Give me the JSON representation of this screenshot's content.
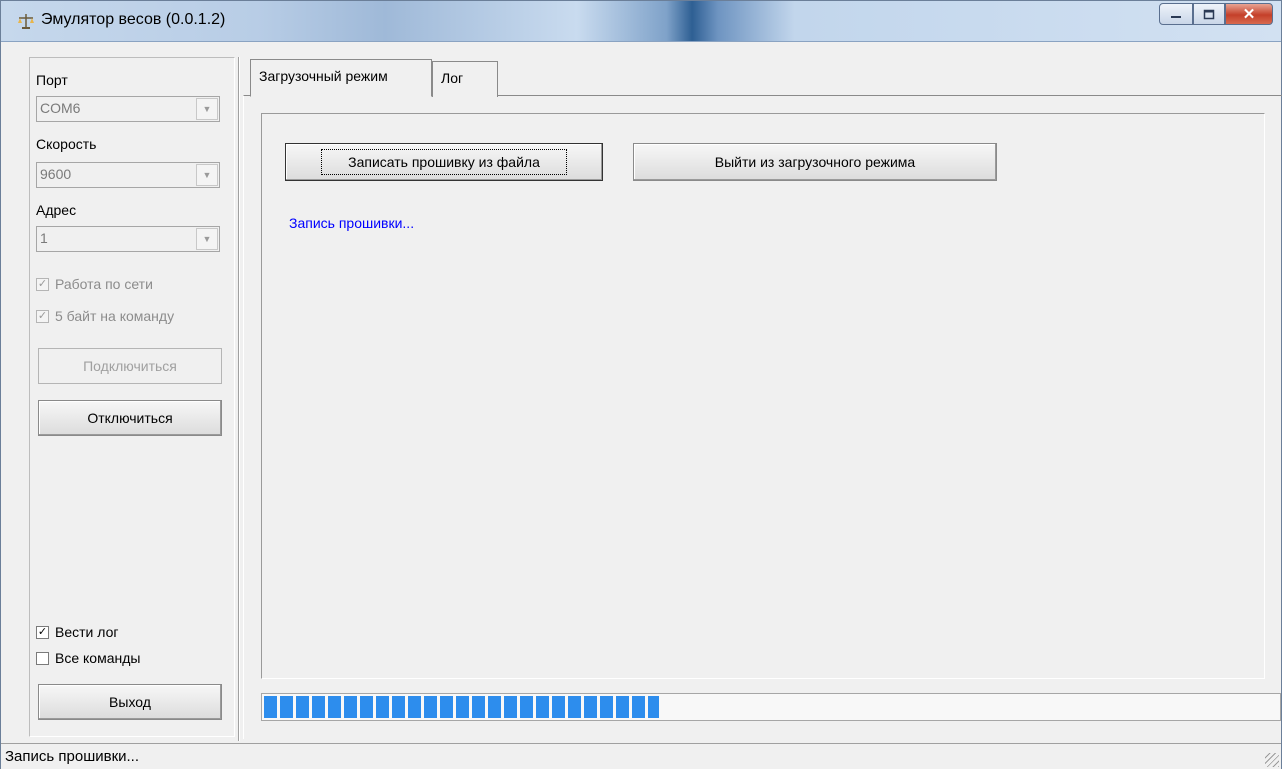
{
  "window": {
    "title": "Эмулятор весов (0.0.1.2)"
  },
  "left": {
    "port_label": "Порт",
    "port_value": "COM6",
    "speed_label": "Скорость",
    "speed_value": "9600",
    "address_label": "Адрес",
    "address_value": "1",
    "network_label": "Работа по сети",
    "network_checked": true,
    "five_bytes_label": "5 байт на команду",
    "five_bytes_checked": true,
    "connect_label": "Подключиться",
    "disconnect_label": "Отключиться",
    "keep_log_label": "Вести лог",
    "keep_log_checked": true,
    "all_commands_label": "Все команды",
    "all_commands_checked": false,
    "exit_label": "Выход"
  },
  "tabs": [
    {
      "label": "Загрузочный режим",
      "active": true
    },
    {
      "label": "Лог",
      "active": false
    }
  ],
  "boot": {
    "write_firmware_label": "Записать прошивку из файла",
    "exit_boot_label": "Выйти из загрузочного режима",
    "status_text": "Запись прошивки...",
    "progress_fraction": 0.39
  },
  "statusbar": {
    "text": "Запись прошивки..."
  },
  "colors": {
    "accent": "#2d8ded",
    "status_text": "#0000ff"
  }
}
